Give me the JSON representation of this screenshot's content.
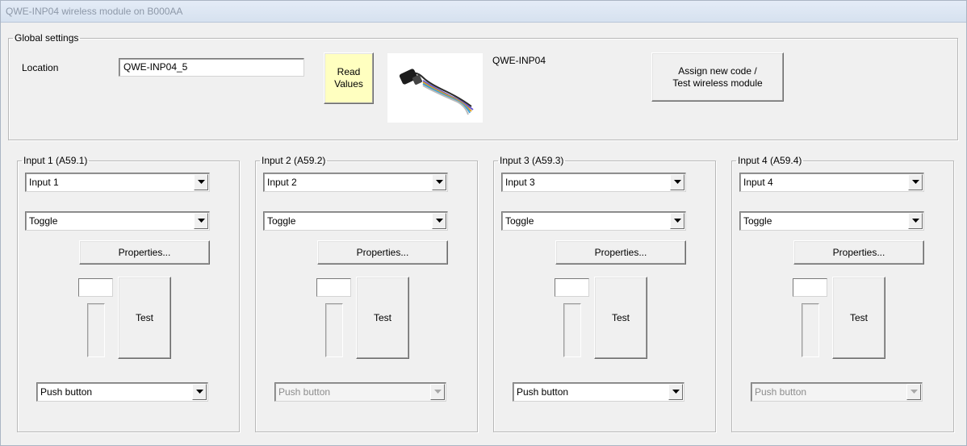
{
  "window": {
    "title": "QWE-INP04 wireless module on B000AA"
  },
  "global": {
    "legend": "Global settings",
    "location_label": "Location",
    "location_value": "QWE-INP04_5",
    "read_values_label": "Read\nValues",
    "module_name": "QWE-INP04",
    "module_image_icon": "cable-module-icon",
    "assign_label": "Assign new code /\nTest wireless module"
  },
  "inputs": [
    {
      "legend": "Input 1 (A59.1)",
      "name": "Input 1",
      "mode": "Toggle",
      "properties_label": "Properties...",
      "test_label": "Test",
      "type": "Push button",
      "type_enabled": true
    },
    {
      "legend": "Input 2 (A59.2)",
      "name": "Input 2",
      "mode": "Toggle",
      "properties_label": "Properties...",
      "test_label": "Test",
      "type": "Push button",
      "type_enabled": false
    },
    {
      "legend": "Input 3 (A59.3)",
      "name": "Input 3",
      "mode": "Toggle",
      "properties_label": "Properties...",
      "test_label": "Test",
      "type": "Push button",
      "type_enabled": true
    },
    {
      "legend": "Input 4 (A59.4)",
      "name": "Input 4",
      "mode": "Toggle",
      "properties_label": "Properties...",
      "test_label": "Test",
      "type": "Push button",
      "type_enabled": false
    }
  ],
  "colors": {
    "read_button_bg": "#ffffc0",
    "window_bg": "#f0f0f0",
    "title_text": "#8d98a8"
  }
}
